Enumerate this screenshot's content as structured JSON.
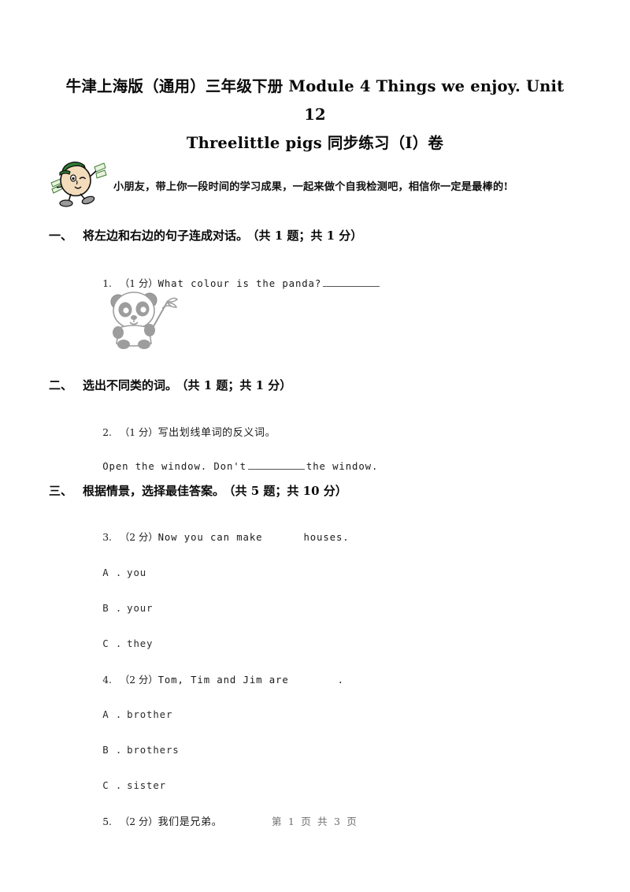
{
  "document": {
    "title_line1": "牛津上海版（通用）三年级下册 Module 4 Things we enjoy. Unit 12",
    "title_line2": "Threelittle pigs 同步练习（I）卷",
    "intro_text": "小朋友，带上你一段时间的学习成果，一起来做个自我检测吧，相信你一定是最棒的!",
    "mascot_icon": "cartoon-boy-mascot-icon",
    "footer": "第 1 页 共 3 页"
  },
  "sections": [
    {
      "number": "一、",
      "title": "将左边和右边的句子连成对话。",
      "meta": "（共 1 题；共 1 分）"
    },
    {
      "number": "二、",
      "title": "选出不同类的词。",
      "meta": "（共 1 题；共 1 分）"
    },
    {
      "number": "三、",
      "title": "根据情景，选择最佳答案。",
      "meta": "（共 5 题；共 10 分）"
    }
  ],
  "questions": [
    {
      "num": "1.",
      "points": "（1 分）",
      "text": "What colour is the panda?",
      "has_blank_after": true,
      "image": "panda-illustration"
    },
    {
      "num": "2.",
      "points": "（1 分）",
      "text": "写出划线单词的反义词。",
      "sentence_before": "Open the window. Don't",
      "sentence_after": "the window."
    },
    {
      "num": "3.",
      "points": "（2 分）",
      "text_before": "Now you can make",
      "text_after": "houses.",
      "options": [
        {
          "letter": "A .",
          "text": "you"
        },
        {
          "letter": "B .",
          "text": "your"
        },
        {
          "letter": "C .",
          "text": "they"
        }
      ]
    },
    {
      "num": "4.",
      "points": "（2 分）",
      "text_before": "Tom, Tim and Jim are",
      "text_after": ".",
      "options": [
        {
          "letter": "A .",
          "text": "brother"
        },
        {
          "letter": "B .",
          "text": "brothers"
        },
        {
          "letter": "C .",
          "text": "sister"
        }
      ]
    },
    {
      "num": "5.",
      "points": "（2 分）",
      "text": "我们是兄弟。"
    }
  ],
  "colors": {
    "page_background": "#ffffff",
    "text": "#000000",
    "footer_text": "#6f6f6f",
    "mascot_cap": "#2e7d32",
    "mascot_skin": "#f2d9b8",
    "panda_grey": "#9a9a9a"
  }
}
